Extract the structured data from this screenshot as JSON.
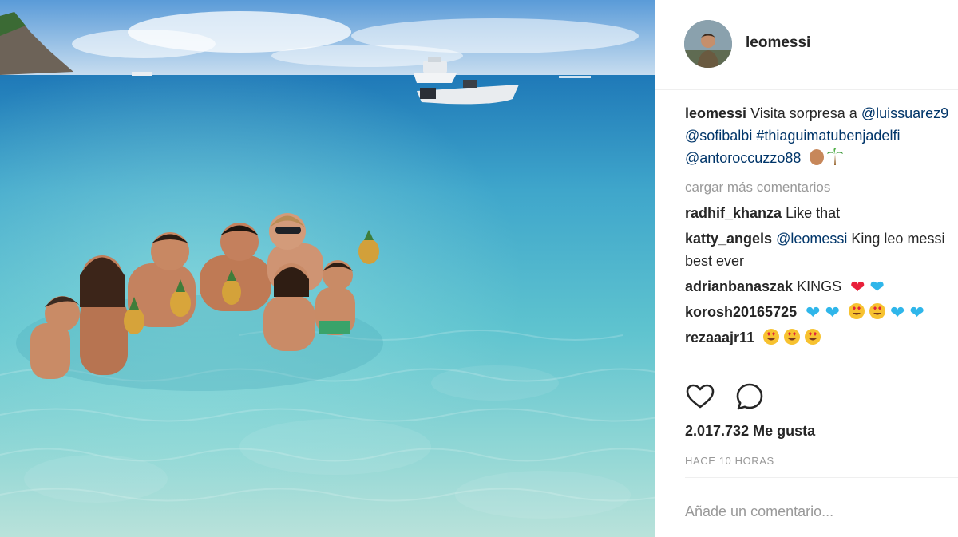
{
  "post": {
    "username": "leomessi",
    "caption": {
      "username": "leomessi",
      "line1_text": "Visita sorpresa a ",
      "line1_tag": "@luissuarez9",
      "line2_tags": "@sofibalbi #thiaguimatubenjadelfi",
      "line3_tag": "@antoroccuzzo88"
    },
    "load_more": "cargar más comentarios",
    "comments": [
      {
        "username": "radhif_khanza",
        "text": "Like that"
      },
      {
        "username": "katty_angels",
        "mention": "@leomessi",
        "text": "King leo messi best ever"
      },
      {
        "username": "adrianbanaszak",
        "text": "KINGS"
      },
      {
        "username": "korosh20165725",
        "text": ""
      },
      {
        "username": "rezaaajr11",
        "text": ""
      }
    ],
    "likes": "2.017.732 Me gusta",
    "time": "HACE 10 HORAS",
    "add_comment_placeholder": "Añade un comentario..."
  },
  "icons": {
    "like": "heart-outline-icon",
    "comment": "speech-bubble-icon"
  },
  "colors": {
    "link": "#003569",
    "muted": "#999999",
    "text": "#262626",
    "heart_red": "#e8203a",
    "heart_blue": "#2fb6ea",
    "emoji_yellow": "#f7c230"
  }
}
